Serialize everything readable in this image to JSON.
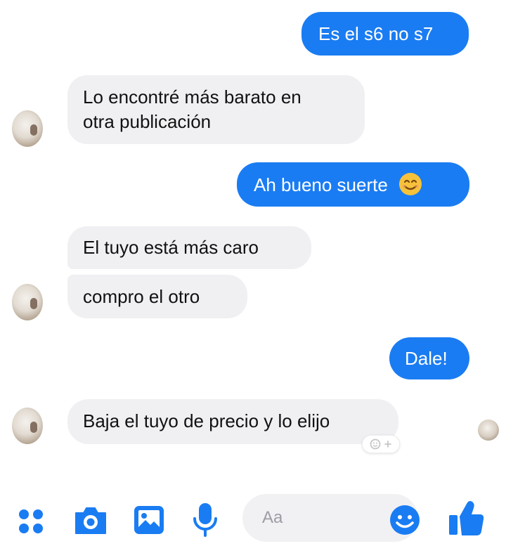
{
  "messages": [
    {
      "id": "m1",
      "sender": "me",
      "text": "Es el s6 no s7"
    },
    {
      "id": "m2",
      "sender": "contact",
      "lines": [
        "Lo encontré más barato en",
        "otra publicación"
      ]
    },
    {
      "id": "m3",
      "sender": "me",
      "text": "Ah bueno suerte",
      "emoji": "smiling-face"
    },
    {
      "id": "m4",
      "sender": "contact",
      "text": "El tuyo está más caro"
    },
    {
      "id": "m5",
      "sender": "contact",
      "text": "compro el otro"
    },
    {
      "id": "m6",
      "sender": "me",
      "text": "Dale!"
    },
    {
      "id": "m7",
      "sender": "contact",
      "text": "Baja el tuyo de precio y lo elijo"
    }
  ],
  "composer": {
    "placeholder": "Aa",
    "icons": [
      "apps-icon",
      "camera-icon",
      "image-icon",
      "microphone-icon",
      "emoji-icon",
      "thumbs-up-icon"
    ]
  },
  "colors": {
    "outgoing_bubble": "#1a7cf2",
    "incoming_bubble": "#f0f0f3",
    "accent": "#1a7cf2"
  }
}
